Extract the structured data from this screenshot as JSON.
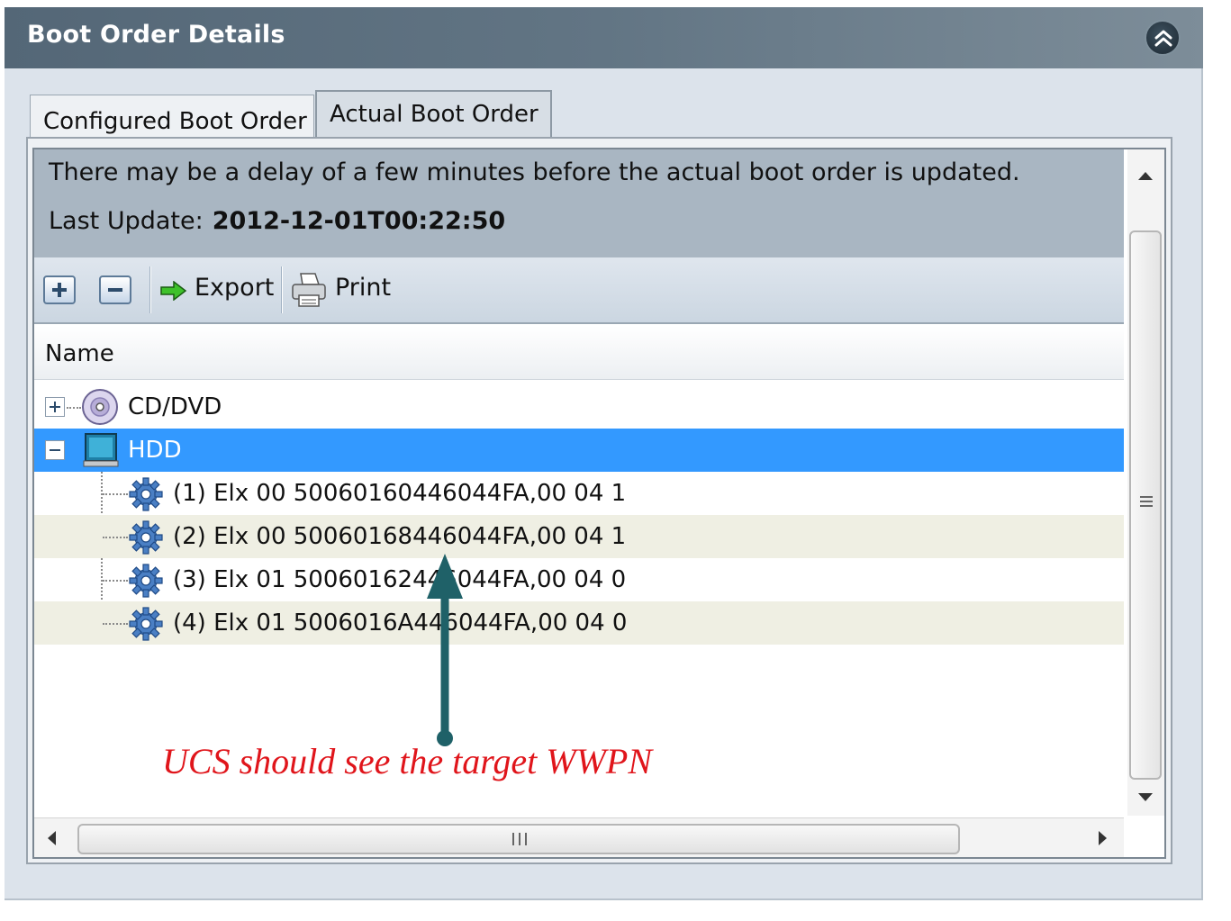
{
  "panel": {
    "title": "Boot Order Details",
    "collapse_icon": "double-chevron-up-icon"
  },
  "tabs": [
    {
      "label": "Configured Boot Order",
      "active": false
    },
    {
      "label": "Actual Boot Order",
      "active": true
    }
  ],
  "info": {
    "message": "There may be a delay of a few minutes before the actual boot order is updated.",
    "last_update_label": "Last Update:",
    "last_update_value": "2012-12-01T00:22:50"
  },
  "toolbar": {
    "expand_icon": "plus-icon",
    "collapse_icon": "minus-icon",
    "export_label": "Export",
    "export_icon": "green-arrow-icon",
    "print_label": "Print",
    "print_icon": "printer-icon"
  },
  "table": {
    "column_name": "Name",
    "rows": [
      {
        "label": "CD/DVD",
        "icon": "cd-icon",
        "expanded": false,
        "selected": false
      },
      {
        "label": "HDD",
        "icon": "hdd-icon",
        "expanded": true,
        "selected": true
      },
      {
        "label": "(1) Elx 00 50060160446044FA,00 04 1",
        "icon": "gear-icon"
      },
      {
        "label": "(2) Elx 00 50060168446044FA,00 04 1",
        "icon": "gear-icon"
      },
      {
        "label": "(3) Elx 01 50060162446044FA,00 04 0",
        "icon": "gear-icon"
      },
      {
        "label": "(4) Elx 01 5006016A446044FA,00 04 0",
        "icon": "gear-icon"
      }
    ]
  },
  "annotation": {
    "text": "UCS should see the target WWPN",
    "color": "#e0151b",
    "arrow_color": "#1f6168"
  },
  "colors": {
    "header_bg": "#546777",
    "selected_row": "#3399ff",
    "info_bg": "#a9b6c2"
  }
}
